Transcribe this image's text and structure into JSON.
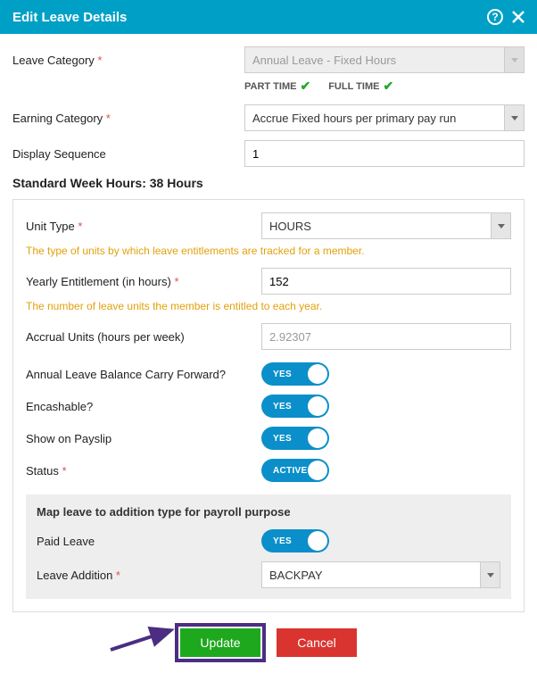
{
  "header": {
    "title": "Edit Leave Details"
  },
  "fields": {
    "leave_category": {
      "label": "Leave Category",
      "value": "Annual Leave - Fixed Hours"
    },
    "badges": {
      "part_time": "PART TIME",
      "full_time": "FULL TIME"
    },
    "earning_category": {
      "label": "Earning Category",
      "value": "Accrue Fixed hours per primary pay run"
    },
    "display_sequence": {
      "label": "Display Sequence",
      "value": "1"
    }
  },
  "standard_week": {
    "title": "Standard Week Hours: 38 Hours"
  },
  "panel": {
    "unit_type": {
      "label": "Unit Type",
      "value": "HOURS",
      "help": "The type of units by which leave entitlements are tracked for a member."
    },
    "yearly_entitlement": {
      "label": "Yearly Entitlement (in hours)",
      "value": "152",
      "help": "The number of leave units the member is entitled to each year."
    },
    "accrual_units": {
      "label": "Accrual Units (hours per week)",
      "value": "2.92307"
    },
    "carry_forward": {
      "label": "Annual Leave Balance Carry Forward?",
      "toggle": "YES"
    },
    "encashable": {
      "label": "Encashable?",
      "toggle": "YES"
    },
    "show_payslip": {
      "label": "Show on Payslip",
      "toggle": "YES"
    },
    "status": {
      "label": "Status",
      "toggle": "ACTIVE"
    }
  },
  "mapping": {
    "title": "Map leave to addition type for payroll purpose",
    "paid_leave": {
      "label": "Paid Leave",
      "toggle": "YES"
    },
    "leave_addition": {
      "label": "Leave Addition",
      "value": "BACKPAY"
    }
  },
  "footer": {
    "update": "Update",
    "cancel": "Cancel"
  }
}
